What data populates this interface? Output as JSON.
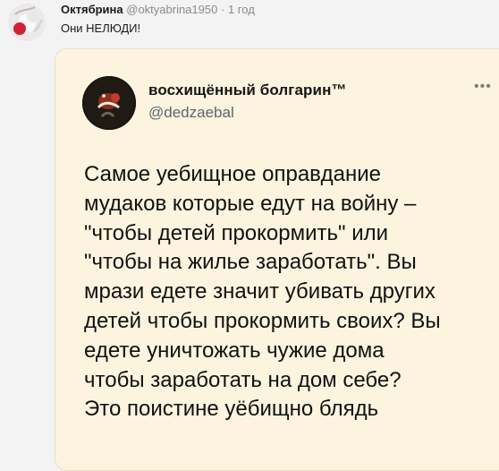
{
  "comment": {
    "author_name": "Октябрина",
    "author_handle": "@oktyabrina1950",
    "separator": "·",
    "time": "1 год",
    "text": "Они НЕЛЮДИ!"
  },
  "quoted_tweet": {
    "author_name": "восхищённый болгарин™",
    "author_handle": "@dedzaebal",
    "more_icon": "more-dots-icon",
    "lines": [
      "Самое уебищное оправдание",
      "мудаков которые едут на войну –",
      "\"чтобы детей прокормить\" или",
      "\"чтобы на жилье заработать\". Вы",
      "мрази едете значит убивать других",
      "детей чтобы прокормить своих? Вы",
      "едете уничтожать чужие дома",
      "чтобы заработать на дом себе?",
      "Это поистине уёбищно блядь"
    ]
  }
}
